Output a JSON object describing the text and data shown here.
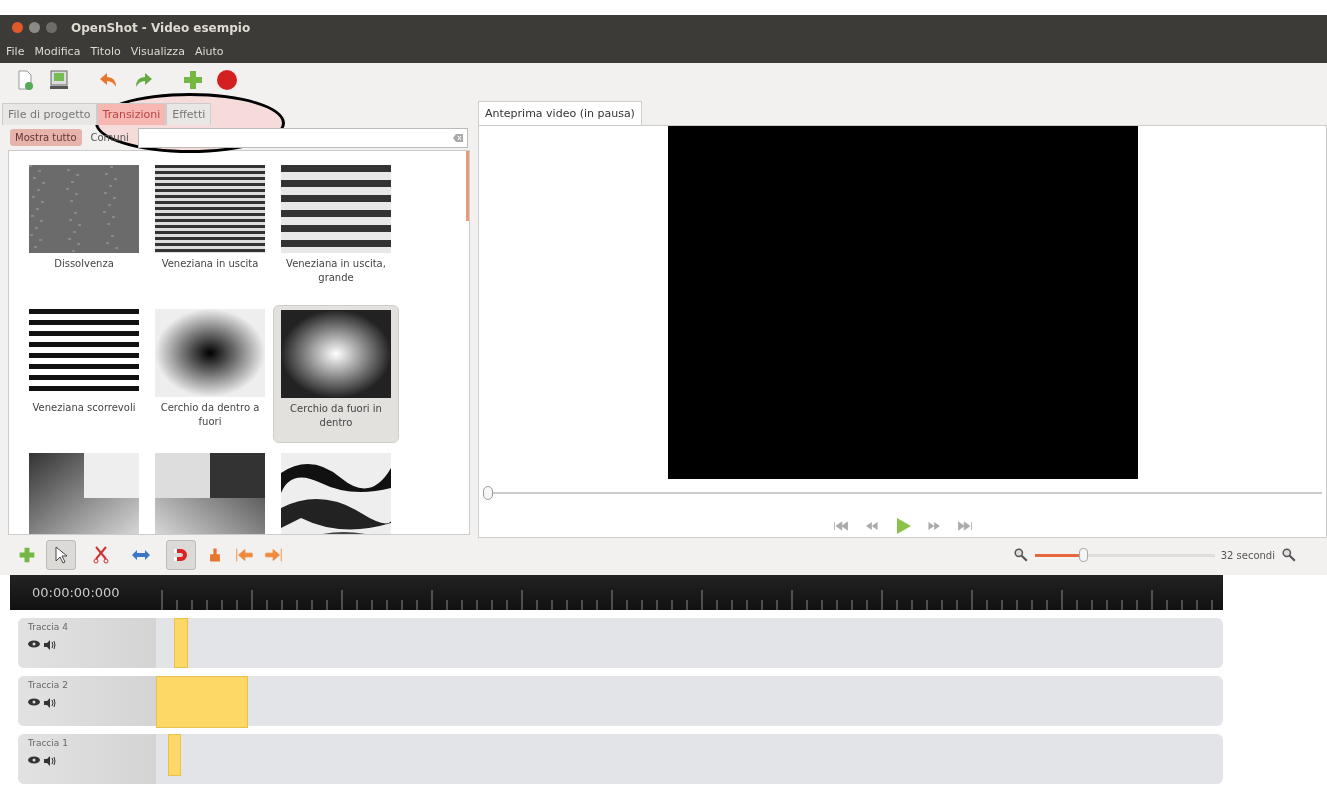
{
  "window": {
    "title": "OpenShot - Video esempio"
  },
  "menu": [
    "File",
    "Modifica",
    "Titolo",
    "Visualizza",
    "Aiuto"
  ],
  "left_tabs": [
    {
      "label": "File di progetto",
      "selected": false
    },
    {
      "label": "Transizioni",
      "selected": true
    },
    {
      "label": "Effetti",
      "selected": false
    }
  ],
  "filters": [
    {
      "label": "Mostra tutto",
      "selected": true
    },
    {
      "label": "Comuni",
      "selected": false
    }
  ],
  "transitions": [
    {
      "label": "Dissolvenza",
      "kind": "noise",
      "selected": false
    },
    {
      "label": "Veneziana in uscita",
      "kind": "thin-stripes",
      "selected": false
    },
    {
      "label": "Veneziana in uscita, grande",
      "kind": "wide-stripes",
      "selected": false
    },
    {
      "label": "Veneziana scorrevoli",
      "kind": "taper-stripes",
      "selected": false
    },
    {
      "label": "Cerchio da dentro a fuori",
      "kind": "radial-dark",
      "selected": false
    },
    {
      "label": "Cerchio da fuori in dentro",
      "kind": "radial-light",
      "selected": true
    },
    {
      "kind": "wipe-left",
      "selected": false
    },
    {
      "kind": "wipe-right",
      "selected": false
    },
    {
      "kind": "marble",
      "selected": false
    }
  ],
  "preview": {
    "tab": "Anteprima video (in pausa)",
    "seek": {
      "level": 0
    }
  },
  "timeline": {
    "zoom": {
      "level": 0.27
    },
    "zoom_reading": "32 secondi",
    "timecode": "00:00:00:000",
    "tools": [
      {
        "kind": "pointer",
        "selected": true
      },
      {
        "kind": "razor",
        "selected": false
      },
      {
        "kind": "resize",
        "selected": false
      },
      {
        "kind": "snap",
        "selected": true
      }
    ],
    "tracks": [
      {
        "name": "Traccia 4"
      },
      {
        "name": "Traccia 2"
      },
      {
        "name": "Traccia 1"
      }
    ]
  }
}
